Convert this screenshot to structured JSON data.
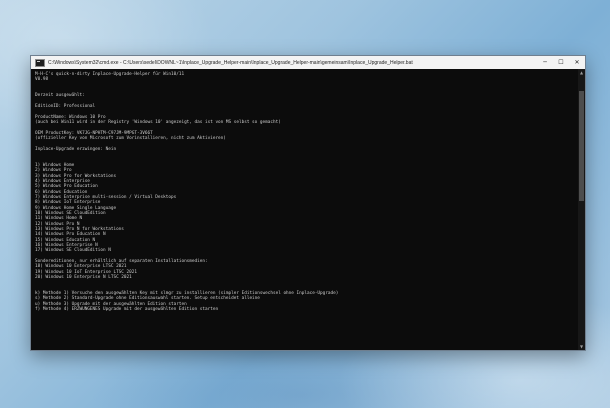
{
  "window": {
    "title": "C:\\Windows\\System32\\cmd.exe - C:\\Users\\sedel\\DOWNL~1\\Inplace_Upgrade_Helper-main\\Inplace_Upgrade_Helper-main\\gemeinsam\\Inplace_Upgrade_Helper.bat",
    "minimize_glyph": "─",
    "maximize_glyph": "☐",
    "close_glyph": "✕",
    "scroll_up_glyph": "▲",
    "scroll_down_glyph": "▼"
  },
  "console": {
    "lines": [
      "M-H-C's quick-n-dirty Inplace-Upgrade-Helper für Win10/11",
      "V0.98",
      "",
      "",
      "Derzeit ausgewählt:",
      "",
      "EditionID: Professional",
      "",
      "ProductName: Windows 10 Pro",
      "(auch bei Win11 wird in der Registry 'Windows 10' angezeigt, das ist von MS selbst so gemacht)",
      "",
      "OEM ProductKey: VK7JG-NPHTM-C97JM-9MPGT-3V66T",
      "(offizieller Key von Microsoft zum Vorinstallieren, nicht zum Aktivieren)",
      "",
      "Inplace-Upgrade erzwingen: Nein",
      "",
      "",
      "1) Windows Home",
      "2) Windows Pro",
      "3) Windows Pro for Workstations",
      "4) Windows Enterprise",
      "5) Windows Pro Education",
      "6) Windows Education",
      "7) Windows Enterprise multi-session / Virtual Desktops",
      "8) Windows IoT Enterprise",
      "9) Windows Home Single Language",
      "10) Windows SE CloudEdition",
      "11) Windows Home N",
      "12) Windows Pro N",
      "13) Windows Pro N for Workstations",
      "14) Windows Pro Education N",
      "15) Windows Education N",
      "16) Windows Enterprise N",
      "17) Windows SE CloudEdition N",
      "",
      "Sondereditionen, nur erhältlich auf separaten Installationsmedien:",
      "18) Windows 10 Enterprise LTSC 2021",
      "19) Windows 10 IoT Enterprise LTSC 2021",
      "20) Windows 10 Enterprise N LTSC 2021",
      "",
      "",
      "k) Methode 1) Versuche den ausgewählten Key mit slmgr zu installieren (simpler Editionswechsel ohne Inplace-Upgrade)",
      "s) Methode 2) Standard-Upgrade ohne Editionsauswahl starten. Setup entscheidet alleine",
      "u) Methode 3) Upgrade mit der ausgewählten Edition starten",
      "f) Methode 4) ERZWUNGENES Upgrade mit der ausgewählten Edition starten"
    ]
  }
}
